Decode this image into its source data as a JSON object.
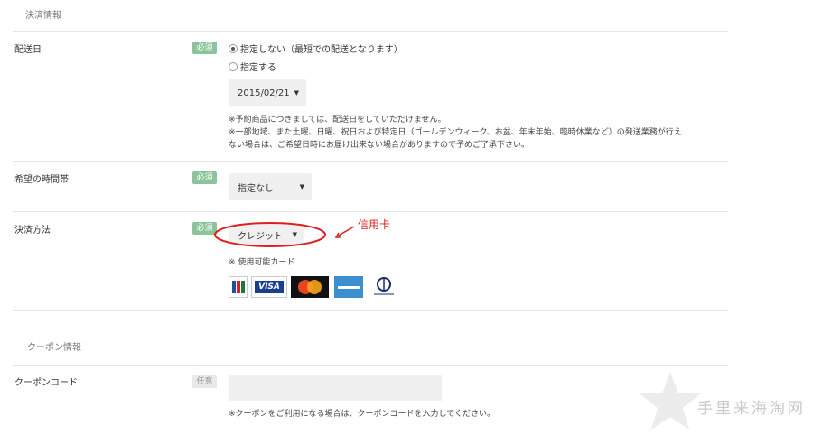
{
  "payment_section": {
    "title": "決済情報"
  },
  "delivery_date": {
    "label": "配送日",
    "badge": "必須",
    "option_unspecified": "指定しない（最短での配送となります）",
    "option_specify": "指定する",
    "selected_option": "指定しない",
    "date_value": "2015/02/21",
    "notes": [
      "※予約商品につきましては、配送日をしていただけません。",
      "※一部地域、また土曜、日曜、祝日および特定日（ゴールデンウィーク、お盆、年末年始、臨時休業など）の発送業務が行え",
      "ない場合は、ご希望日時にお届け出来ない場合がありますので予めご了承下さい。"
    ]
  },
  "delivery_time": {
    "label": "希望の時間帯",
    "badge": "必須",
    "value": "指定なし"
  },
  "payment_method": {
    "label": "決済方法",
    "badge": "必須",
    "value": "クレジット",
    "cards_note": "※ 使用可能カード",
    "annotation": "信用卡",
    "cards": [
      {
        "name": "JCB",
        "color": "#1a7a3a"
      },
      {
        "name": "VISA",
        "color": "#1a3f8f"
      },
      {
        "name": "MasterCard",
        "color": "#e8451e"
      },
      {
        "name": "AMERICAN EXPRESS",
        "color": "#3b8fd0"
      },
      {
        "name": "Diners Club International",
        "color": "#1b2a6b"
      }
    ]
  },
  "coupon_section": {
    "title": "クーポン情報"
  },
  "coupon_code": {
    "label": "クーポンコード",
    "badge": "任意",
    "value": "",
    "note": "※クーポンをご利用になる場合は、クーポンコードを入力してください。"
  },
  "watermark": "手里来海淘网"
}
